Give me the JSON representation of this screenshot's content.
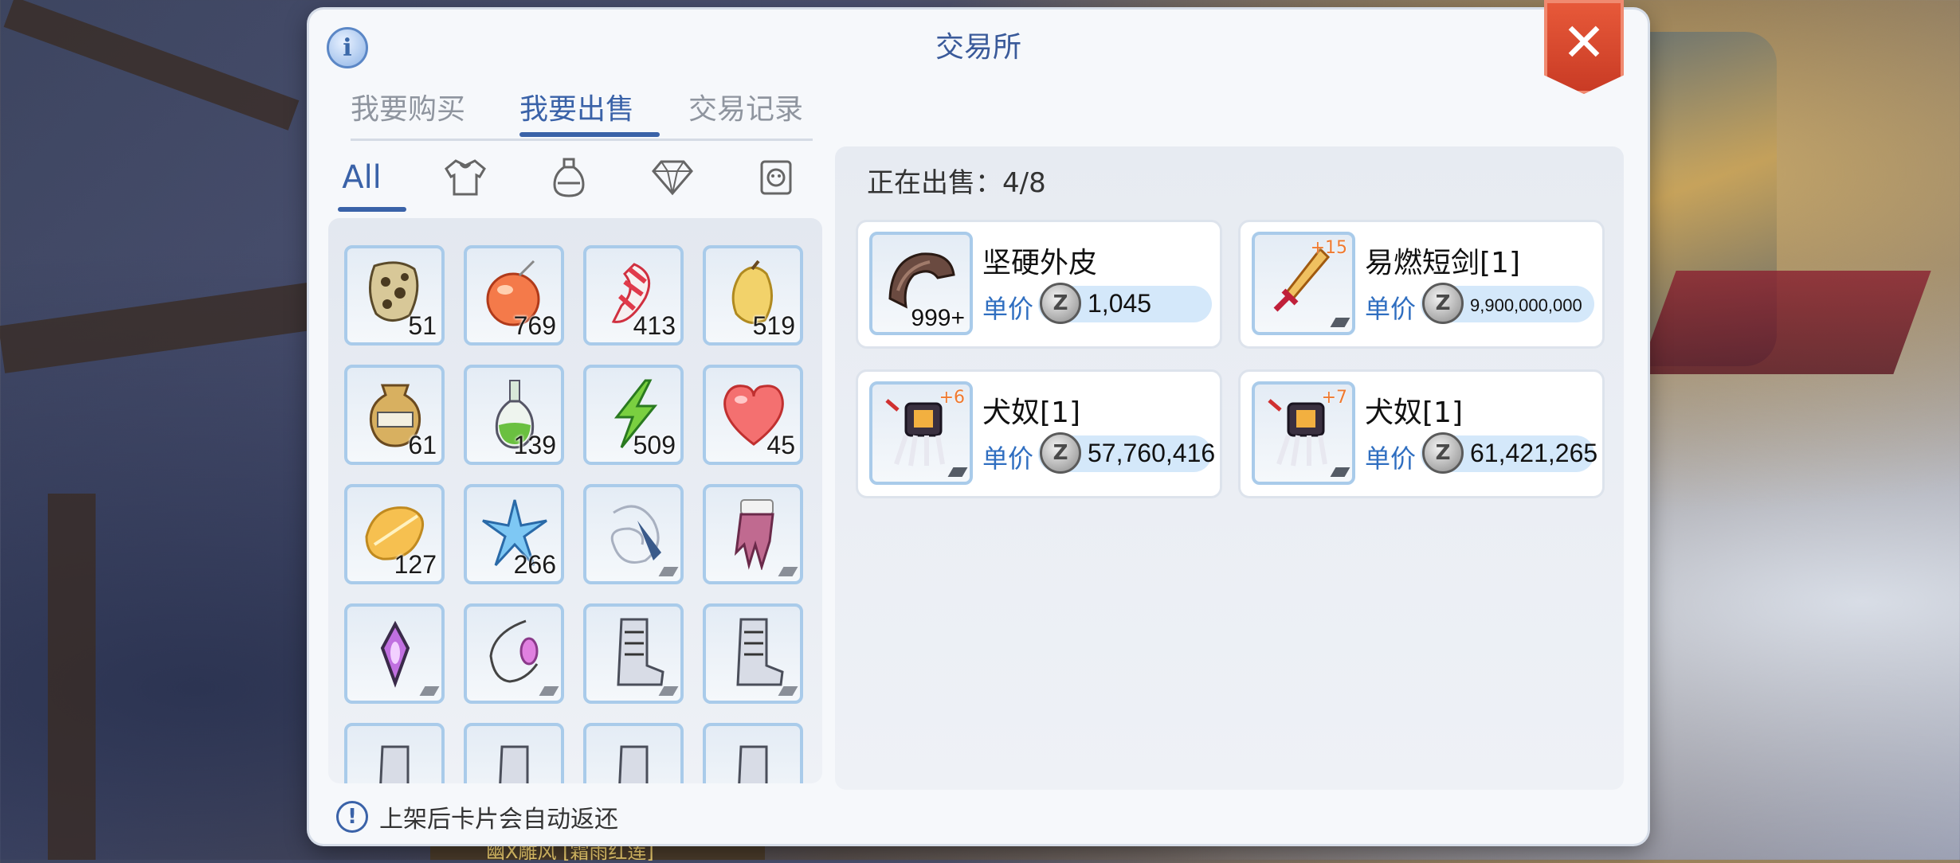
{
  "title": "交易所",
  "info_icon": "i",
  "close_icon": "✕",
  "main_tabs": [
    {
      "label": "我要购买",
      "active": false
    },
    {
      "label": "我要出售",
      "active": true
    },
    {
      "label": "交易记录",
      "active": false
    }
  ],
  "categories": {
    "all_label": "All",
    "icons": [
      "armor-icon",
      "potion-icon",
      "gem-icon",
      "card-icon"
    ]
  },
  "inventory": [
    {
      "icon": "hard-skin-item-icon",
      "qty": "51"
    },
    {
      "icon": "apple-item-icon",
      "qty": "769"
    },
    {
      "icon": "candy-item-icon",
      "qty": "413"
    },
    {
      "icon": "pear-item-icon",
      "qty": "519"
    },
    {
      "icon": "jar-item-icon",
      "qty": "61"
    },
    {
      "icon": "green-bottle-item-icon",
      "qty": "139"
    },
    {
      "icon": "lightning-item-icon",
      "qty": "509"
    },
    {
      "icon": "heart-item-icon",
      "qty": "45"
    },
    {
      "icon": "leaf-item-icon",
      "qty": "127"
    },
    {
      "icon": "crystal-item-icon",
      "qty": "266"
    },
    {
      "icon": "fish-item-icon",
      "qty": ""
    },
    {
      "icon": "glove-item-icon",
      "qty": ""
    },
    {
      "icon": "amulet-item-icon",
      "qty": ""
    },
    {
      "icon": "necklace-item-icon",
      "qty": ""
    },
    {
      "icon": "boots-item-icon",
      "qty": ""
    },
    {
      "icon": "boots-item-icon",
      "qty": ""
    },
    {
      "icon": "boots-item-icon",
      "qty": ""
    },
    {
      "icon": "boots-item-icon",
      "qty": ""
    },
    {
      "icon": "boots-item-icon",
      "qty": ""
    },
    {
      "icon": "boots-item-icon",
      "qty": ""
    }
  ],
  "tip": "上架后卡片会自动返还",
  "selling": {
    "header": "正在出售：4/8",
    "price_label": "单价",
    "zeny_icon": "Z",
    "items": [
      {
        "name": "坚硬外皮",
        "price": "1,045",
        "qty": "999+",
        "refine": "",
        "icon": "hard-skin-icon"
      },
      {
        "name": "易燃短剑[1]",
        "price": "9,900,000,000",
        "qty": "",
        "refine": "+15",
        "icon": "fire-dagger-icon"
      },
      {
        "name": "犬奴[1]",
        "price": "57,760,416",
        "qty": "",
        "refine": "+6",
        "icon": "claw-icon"
      },
      {
        "name": "犬奴[1]",
        "price": "61,421,265",
        "qty": "",
        "refine": "+7",
        "icon": "claw-icon"
      }
    ]
  },
  "background_nameplate": "幽X雕风 [霜雨红莲]",
  "colors": {
    "accent": "#3a62a8",
    "price_blue": "#2f6ec0",
    "close_red": "#d8452c",
    "refine_orange": "#f07a30"
  }
}
